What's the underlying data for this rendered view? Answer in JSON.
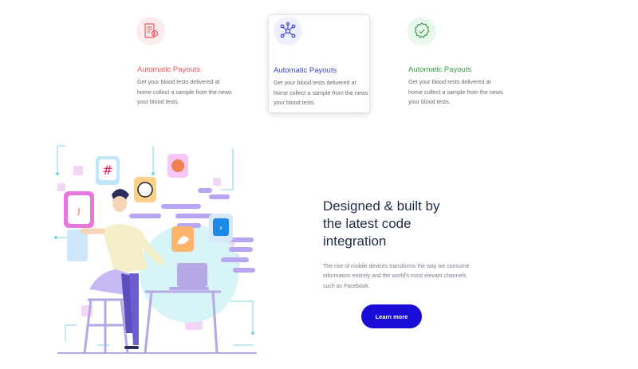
{
  "features": [
    {
      "title": "Automatic Payouts",
      "description": "Get your blood tests delivered at home collect a sample from the news your blood tests.",
      "icon": "invoice-icon",
      "accent": "#e8595c",
      "icon_bg": "#fdecee"
    },
    {
      "title": "Automatic Payouts",
      "description": "Get your blood tests delivered at home collect a sample from the news your blood tests.",
      "icon": "network-icon",
      "accent": "#3a43d6",
      "icon_bg": "#eef0fd"
    },
    {
      "title": "Automatic Payouts",
      "description": "Get your blood tests delivered at home collect a sample from the news your blood tests.",
      "icon": "award-badge-icon",
      "accent": "#3e9a4f",
      "icon_bg": "#eaf7ec"
    }
  ],
  "integration": {
    "headline_line1": "Designed & built by",
    "headline_line2": "the latest code",
    "headline_line3": "integration",
    "body": "The rise of mobile devices transforms the way we consume information entirely and the world's most elevant channels such as Facebook.",
    "cta_label": "Learn more",
    "cta_color": "#1b0bd6"
  }
}
